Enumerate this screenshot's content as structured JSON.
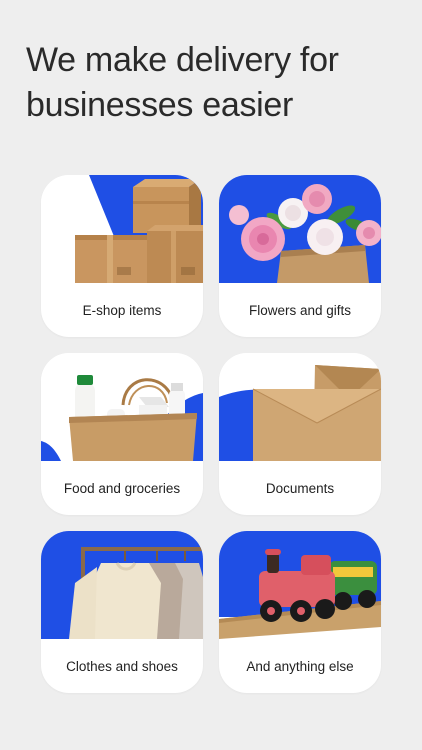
{
  "headline": "We make delivery for businesses easier",
  "accent_color": "#1f4fe5",
  "cards": [
    {
      "label": "E-shop items",
      "icon": "cardboard-boxes"
    },
    {
      "label": "Flowers and gifts",
      "icon": "flower-bouquet"
    },
    {
      "label": "Food and groceries",
      "icon": "grocery-bag"
    },
    {
      "label": "Documents",
      "icon": "envelopes"
    },
    {
      "label": "Clothes and shoes",
      "icon": "clothes-rack"
    },
    {
      "label": "And anything else",
      "icon": "toy-train"
    }
  ]
}
